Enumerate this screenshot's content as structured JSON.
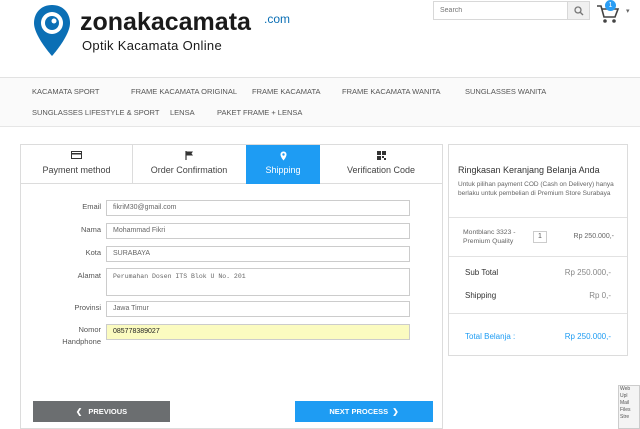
{
  "brand": {
    "name": "zonakacamata",
    "com": ".com",
    "tagline": "Optik Kacamata Online"
  },
  "search": {
    "placeholder": "Search"
  },
  "cart": {
    "count": "1"
  },
  "nav": {
    "items": [
      "KACAMATA SPORT",
      "FRAME KACAMATA ORIGINAL",
      "FRAME KACAMATA",
      "FRAME KACAMATA WANITA",
      "SUNGLASSES WANITA",
      "SUNGLASSES LIFESTYLE & SPORT",
      "LENSA",
      "PAKET FRAME + LENSA"
    ]
  },
  "steps": [
    {
      "label": "Payment method",
      "icon": "credit-card-icon"
    },
    {
      "label": "Order Confirmation",
      "icon": "flag-icon"
    },
    {
      "label": "Shipping",
      "icon": "map-marker-icon"
    },
    {
      "label": "Verification Code",
      "icon": "qrcode-icon"
    }
  ],
  "form": {
    "email": {
      "label": "Email",
      "value": "fikriM30@gmail.com"
    },
    "nama": {
      "label": "Nama",
      "value": "Mohammad Fikri"
    },
    "kota": {
      "label": "Kota",
      "value": "SURABAYA"
    },
    "alamat": {
      "label": "Alamat",
      "value": "Perumahan Dosen ITS Blok U No. 201"
    },
    "provinsi": {
      "label": "Provinsi",
      "value": "Jawa Timur"
    },
    "nomor": {
      "label1": "Nomor",
      "label2": "Handphone",
      "value": "085778389027"
    }
  },
  "buttons": {
    "prev": "PREVIOUS",
    "next": "NEXT PROCESS"
  },
  "summary": {
    "title": "Ringkasan Keranjang Belanja Anda",
    "note": "Untuk pilihan payment COD (Cash on Delivery) hanya berlaku untuk pembelian di Premium Store Surabaya",
    "item": {
      "name": "Montblanc 3323 - Premium Quality",
      "qty": "1",
      "price": "Rp 250.000,-"
    },
    "subtotal_label": "Sub Total",
    "subtotal": "Rp 250.000,-",
    "shipping_label": "Shipping",
    "shipping": "Rp 0,-",
    "total_label": "Total Belanja :",
    "total": "Rp 250.000,-"
  },
  "side_widget": {
    "items": [
      "Web",
      "Upl",
      "Mail",
      "Files",
      "Stre"
    ]
  },
  "colors": {
    "accent": "#1e9cf3",
    "brand": "#0b6fb5",
    "prev_button": "#6b6e70",
    "highlight": "#fbfbc0"
  }
}
